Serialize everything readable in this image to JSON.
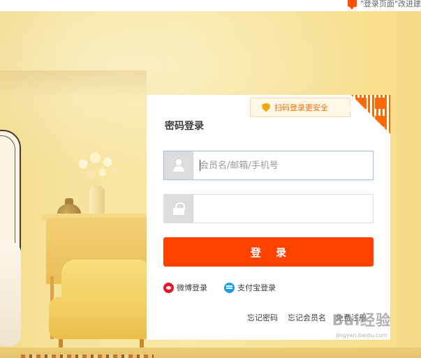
{
  "topbar": {
    "feedback_text": "\"登录页面\"改进建"
  },
  "login": {
    "title": "密码登录",
    "qr_tip": "扫码登录更安全",
    "username_placeholder": "会员名/邮箱/手机号",
    "username_value": "",
    "password_value": "",
    "submit_label": "登 录",
    "social": [
      {
        "label": "微博登录",
        "icon": "weibo-icon"
      },
      {
        "label": "支付宝登录",
        "icon": "alipay-icon"
      }
    ],
    "links": {
      "forgot_password": "忘记密码",
      "forgot_username": "忘记会员名",
      "register": "免费注册"
    }
  },
  "watermark": {
    "logo": "Bai经验",
    "url": "jingyan.baidu.com"
  },
  "colors": {
    "accent": "#ff4200",
    "qr_orange": "#ff6a00",
    "banner_yellow": "#f8e296"
  }
}
